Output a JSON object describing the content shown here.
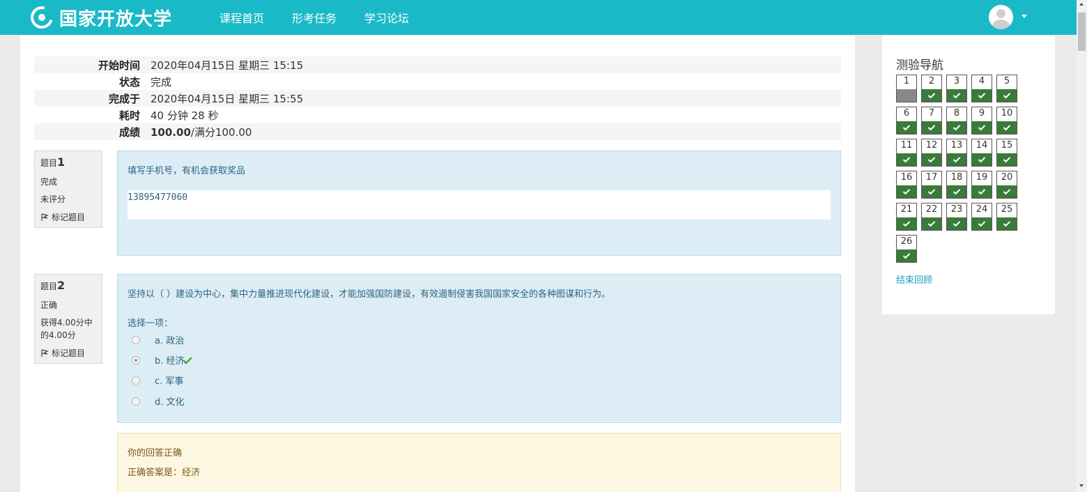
{
  "header": {
    "logo_text": "国家开放大学",
    "nav": [
      "课程首页",
      "形考任务",
      "学习论坛"
    ]
  },
  "summary": {
    "rows": [
      {
        "label": "开始时间",
        "value": "2020年04月15日 星期三 15:15"
      },
      {
        "label": "状态",
        "value": "完成"
      },
      {
        "label": "完成于",
        "value": "2020年04月15日 星期三 15:55"
      },
      {
        "label": "耗时",
        "value": "40 分钟 28 秒"
      },
      {
        "label": "成绩",
        "score": "100.00",
        "score_suffix": "/满分100.00"
      }
    ]
  },
  "questions": [
    {
      "label_prefix": "题目",
      "number": "1",
      "status": "完成",
      "grade": "未评分",
      "flag_label": "标记题目",
      "text": "填写手机号，有机会获取奖品",
      "answer": "13895477060"
    },
    {
      "label_prefix": "题目",
      "number": "2",
      "status": "正确",
      "grade": "获得4.00分中的4.00分",
      "flag_label": "标记题目",
      "text": "坚持以（   ）建设为中心，集中力量推进现代化建设，才能加强国防建设，有效遏制侵害我国国家安全的各种图谋和行为。",
      "prompt": "选择一项：",
      "options": [
        "a. 政治",
        "b. 经济",
        "c. 军事",
        "d. 文化"
      ],
      "selected_index": 1,
      "feedback_title": "你的回答正确",
      "feedback_answer": "正确答案是：经济"
    }
  ],
  "quiz_nav": {
    "title": "测验导航",
    "buttons": [
      "1",
      "2",
      "3",
      "4",
      "5",
      "6",
      "7",
      "8",
      "9",
      "10",
      "11",
      "12",
      "13",
      "14",
      "15",
      "16",
      "17",
      "18",
      "19",
      "20",
      "21",
      "22",
      "23",
      "24",
      "25",
      "26"
    ],
    "finish_label": "结束回顾"
  },
  "colors": {
    "topbar": "#1ab9c8",
    "correct": "#3a7a3a",
    "question_bg": "#dcedf6",
    "feedback_bg": "#fdf6e1"
  },
  "icons": {
    "logo": "university-logo-icon",
    "avatar": "user-avatar-icon",
    "flag": "flag-icon",
    "check": "check-icon"
  }
}
